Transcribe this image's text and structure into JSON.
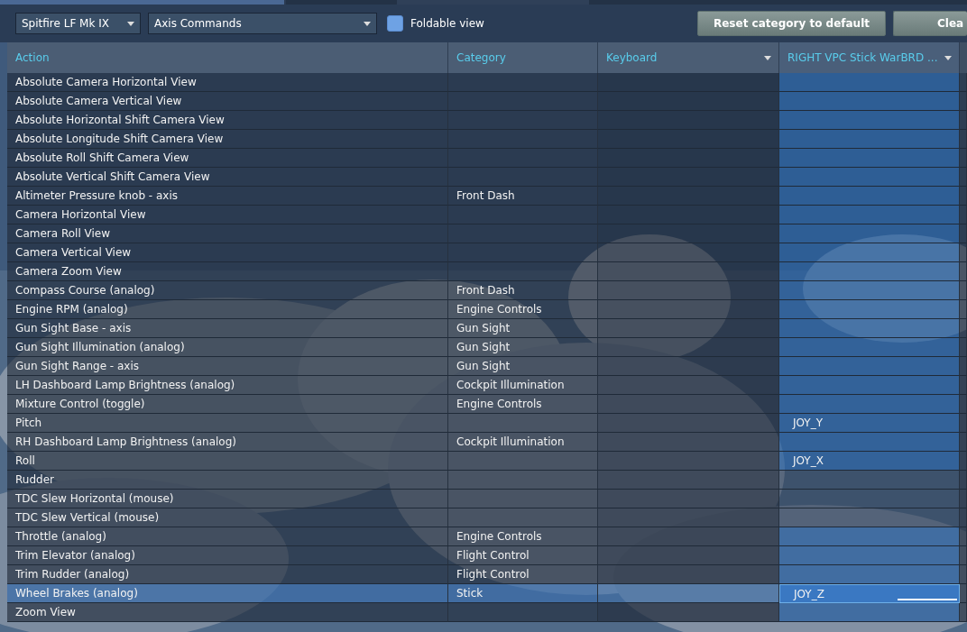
{
  "toolbar": {
    "aircraft": "Spitfire LF Mk IX",
    "category_filter": "Axis Commands",
    "foldable_view": {
      "label": "Foldable view",
      "checked": false
    },
    "buttons": [
      "Reset category to default",
      "Clea"
    ]
  },
  "table": {
    "columns": [
      {
        "label": "Action",
        "dropdown": false
      },
      {
        "label": "Category",
        "dropdown": false
      },
      {
        "label": "Keyboard",
        "dropdown": true
      },
      {
        "label": "RIGHT VPC Stick WarBRD ...",
        "dropdown": true
      }
    ],
    "rows": [
      {
        "action": "Absolute Camera Horizontal View",
        "category": "",
        "joystick": "",
        "assignable": true,
        "selected": false
      },
      {
        "action": "Absolute Camera Vertical View",
        "category": "",
        "joystick": "",
        "assignable": true,
        "selected": false
      },
      {
        "action": "Absolute Horizontal Shift Camera View",
        "category": "",
        "joystick": "",
        "assignable": true,
        "selected": false
      },
      {
        "action": "Absolute Longitude Shift Camera View",
        "category": "",
        "joystick": "",
        "assignable": true,
        "selected": false
      },
      {
        "action": "Absolute Roll Shift Camera View",
        "category": "",
        "joystick": "",
        "assignable": true,
        "selected": false
      },
      {
        "action": "Absolute Vertical Shift Camera View",
        "category": "",
        "joystick": "",
        "assignable": true,
        "selected": false
      },
      {
        "action": "Altimeter Pressure knob - axis",
        "category": "Front Dash",
        "joystick": "",
        "assignable": true,
        "selected": false
      },
      {
        "action": "Camera Horizontal View",
        "category": "",
        "joystick": "",
        "assignable": true,
        "selected": false
      },
      {
        "action": "Camera Roll View",
        "category": "",
        "joystick": "",
        "assignable": true,
        "selected": false
      },
      {
        "action": "Camera Vertical View",
        "category": "",
        "joystick": "",
        "assignable": true,
        "selected": false
      },
      {
        "action": "Camera Zoom View",
        "category": "",
        "joystick": "",
        "assignable": true,
        "selected": false
      },
      {
        "action": "Compass Course (analog)",
        "category": "Front Dash",
        "joystick": "",
        "assignable": true,
        "selected": false
      },
      {
        "action": "Engine RPM (analog)",
        "category": "Engine Controls",
        "joystick": "",
        "assignable": true,
        "selected": false
      },
      {
        "action": "Gun Sight Base - axis",
        "category": "Gun Sight",
        "joystick": "",
        "assignable": true,
        "selected": false
      },
      {
        "action": "Gun Sight Illumination (analog)",
        "category": "Gun Sight",
        "joystick": "",
        "assignable": true,
        "selected": false
      },
      {
        "action": "Gun Sight Range - axis",
        "category": "Gun Sight",
        "joystick": "",
        "assignable": true,
        "selected": false
      },
      {
        "action": "LH Dashboard Lamp Brightness (analog)",
        "category": "Cockpit Illumination",
        "joystick": "",
        "assignable": true,
        "selected": false
      },
      {
        "action": "Mixture Control (toggle)",
        "category": "Engine Controls",
        "joystick": "",
        "assignable": true,
        "selected": false
      },
      {
        "action": "Pitch",
        "category": "",
        "joystick": "JOY_Y",
        "assignable": true,
        "selected": false
      },
      {
        "action": "RH Dashboard Lamp Brightness (analog)",
        "category": "Cockpit Illumination",
        "joystick": "",
        "assignable": true,
        "selected": false
      },
      {
        "action": "Roll",
        "category": "",
        "joystick": "JOY_X",
        "assignable": true,
        "selected": false
      },
      {
        "action": "Rudder",
        "category": "",
        "joystick": "",
        "assignable": false,
        "selected": false
      },
      {
        "action": "TDC Slew Horizontal (mouse)",
        "category": "",
        "joystick": "",
        "assignable": false,
        "selected": false
      },
      {
        "action": "TDC Slew Vertical (mouse)",
        "category": "",
        "joystick": "",
        "assignable": false,
        "selected": false
      },
      {
        "action": "Throttle (analog)",
        "category": "Engine Controls",
        "joystick": "",
        "assignable": true,
        "selected": false
      },
      {
        "action": "Trim Elevator (analog)",
        "category": "Flight Control",
        "joystick": "",
        "assignable": true,
        "selected": false
      },
      {
        "action": "Trim Rudder (analog)",
        "category": "Flight Control",
        "joystick": "",
        "assignable": true,
        "selected": false
      },
      {
        "action": "Wheel Brakes (analog)",
        "category": "Stick",
        "joystick": "JOY_Z",
        "assignable": true,
        "selected": true
      },
      {
        "action": "Zoom View",
        "category": "",
        "joystick": "",
        "assignable": true,
        "selected": false
      }
    ]
  }
}
